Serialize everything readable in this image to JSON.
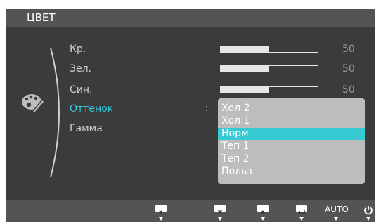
{
  "window": {
    "title": "ЦВЕТ"
  },
  "menu": {
    "items": [
      {
        "label": "Кр.",
        "value": "50",
        "level": 0.5
      },
      {
        "label": "Зел.",
        "value": "50",
        "level": 0.5
      },
      {
        "label": "Син.",
        "value": "50",
        "level": 0.5
      },
      {
        "label": "Оттенок"
      },
      {
        "label": "Гамма"
      }
    ],
    "separator": ":"
  },
  "dropdown": {
    "options": [
      "Хол 2",
      "Хол 1",
      "Норм.",
      "Теп 1",
      "Теп 2",
      "Польз."
    ],
    "selected": "Норм."
  },
  "buttons": {
    "left": "left-arrow-icon",
    "down": "down-arrow-icon",
    "up": "up-arrow-icon",
    "enter": "enter-icon",
    "auto_label": "AUTO",
    "power": "power-icon"
  },
  "colors": {
    "accent": "#33c8d8",
    "panel": "#3b3b3b",
    "bars": "#545454",
    "dropdown_bg": "#bdbdbd"
  }
}
